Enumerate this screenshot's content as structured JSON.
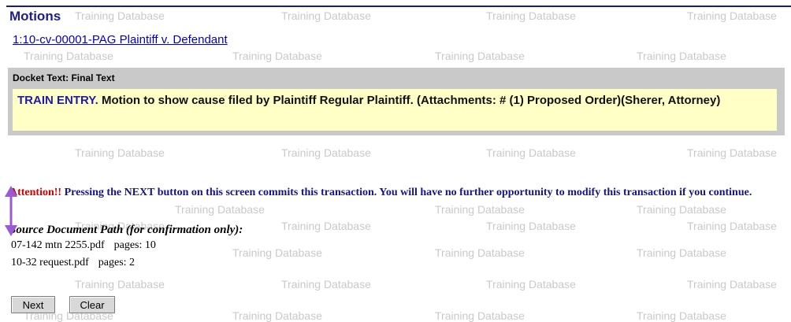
{
  "header": {
    "title": "Motions",
    "case_link": "1:10-cv-00001-PAG Plaintiff v. Defendant"
  },
  "watermark_text": "Training Database",
  "docket": {
    "label": "Docket Text: Final Text",
    "lead": "TRAIN ENTRY.",
    "body": " Motion to show cause filed by Plaintiff Regular Plaintiff. (Attachments: # (1) Proposed Order)(Sherer, Attorney)"
  },
  "attention": {
    "warn": "Attention!!",
    "message": " Pressing the NEXT button on this screen commits this transaction. You will have no further opportunity to modify this transaction if you continue."
  },
  "source": {
    "title": "Source Document Path (for confirmation only):",
    "documents": [
      {
        "file": "07-142 mtn 2255.pdf",
        "pages": "pages: 10"
      },
      {
        "file": "10-32 request.pdf",
        "pages": "pages: 2"
      }
    ]
  },
  "buttons": {
    "next": "Next",
    "clear": "Clear"
  },
  "colors": {
    "title": "#1e1e8f",
    "link": "#0000c8",
    "docket_bg": "#c9c9c9",
    "docket_text_bg": "#ffffc6",
    "warn": "#d00000",
    "annotation_arrow": "#9b59d6"
  }
}
